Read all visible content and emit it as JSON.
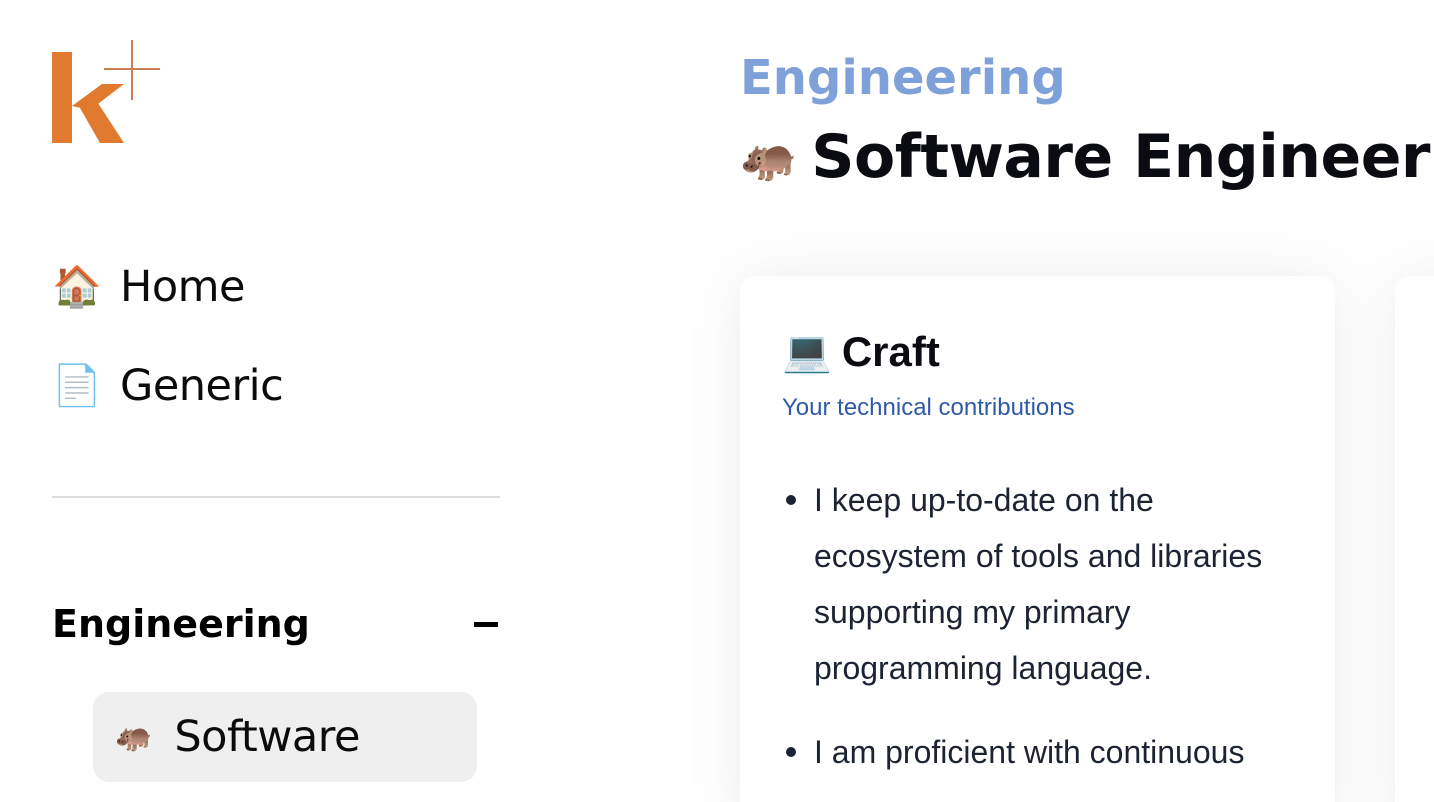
{
  "sidebar": {
    "logo": {
      "letter": "k",
      "accent": "+",
      "color": "#e07a2f"
    },
    "nav": [
      {
        "emoji": "🏠",
        "icon": "house-icon",
        "label": "Home"
      },
      {
        "emoji": "📄",
        "icon": "document-icon",
        "label": "Generic"
      }
    ],
    "section": {
      "title": "Engineering",
      "collapse_icon": "minus-icon",
      "items": [
        {
          "emoji": "🦛",
          "icon": "hippo-icon",
          "label": "Software",
          "active": true
        }
      ]
    }
  },
  "main": {
    "breadcrumb": "Engineering",
    "title_emoji": "🦛",
    "title": "Software Engineering",
    "cards": [
      {
        "emoji": "💻",
        "icon": "laptop-icon",
        "title": "Craft",
        "subtitle": "Your technical contributions",
        "bullets": [
          "I keep up-to-date on the ecosystem of tools and libraries supporting my primary programming language.",
          "I am proficient with continuous"
        ]
      }
    ]
  },
  "colors": {
    "breadcrumb": "#7ea1d9",
    "subtitle": "#2f5aa8",
    "active_bg": "#efefef",
    "logo": "#e07a2f"
  }
}
